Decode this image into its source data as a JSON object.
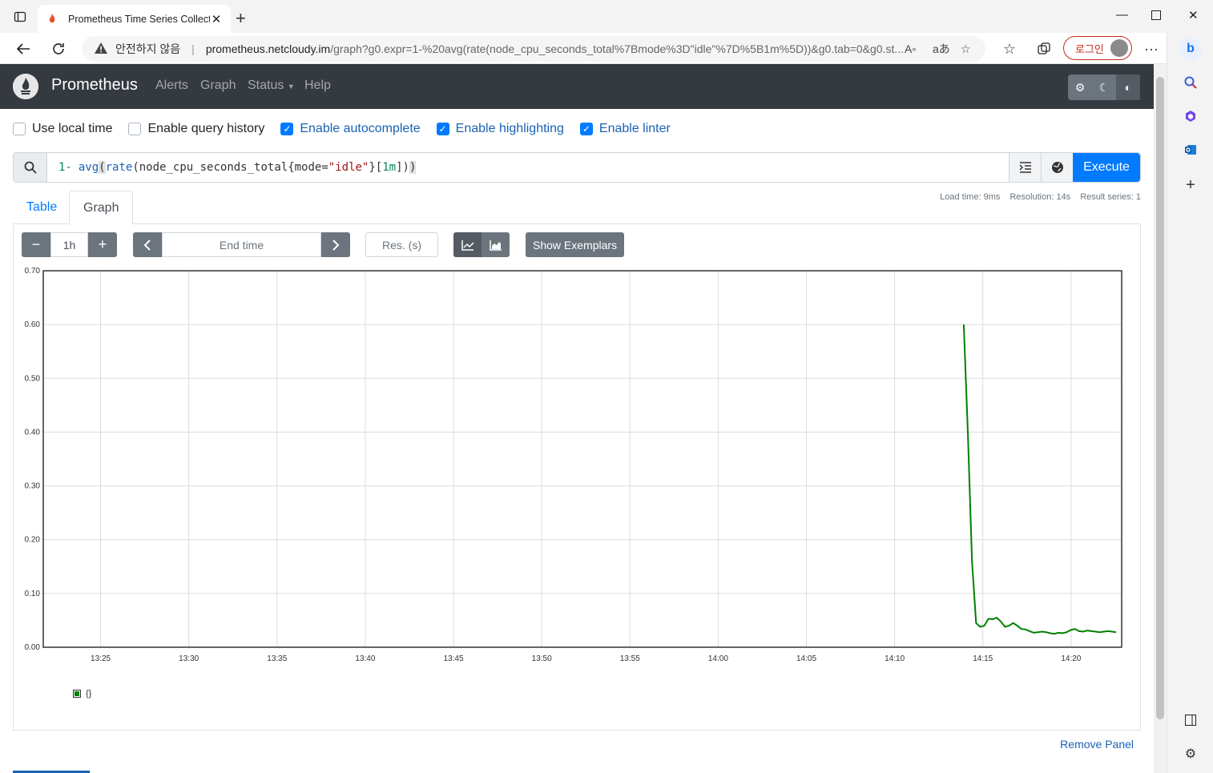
{
  "browser": {
    "tab_title": "Prometheus Time Series Collection and Processing Server",
    "insecure_label": "안전하지 않음",
    "url_host": "prometheus.netcloudy.im",
    "url_rest": "/graph?g0.expr=1-%20avg(rate(node_cpu_seconds_total%7Bmode%3D\"idle\"%7D%5B1m%5D))&g0.tab=0&g0.st...",
    "login_label": "로그인"
  },
  "navbar": {
    "brand": "Prometheus",
    "links": [
      "Alerts",
      "Graph",
      "Status",
      "Help"
    ]
  },
  "options": {
    "use_local_time": {
      "label": "Use local time",
      "checked": false
    },
    "query_history": {
      "label": "Enable query history",
      "checked": false
    },
    "autocomplete": {
      "label": "Enable autocomplete",
      "checked": true
    },
    "highlighting": {
      "label": "Enable highlighting",
      "checked": true
    },
    "linter": {
      "label": "Enable linter",
      "checked": true
    }
  },
  "query": {
    "num": "1-",
    "fn1": "avg",
    "fn2": "rate",
    "metric": "node_cpu_seconds_total",
    "label_key": "mode",
    "label_val": "\"idle\"",
    "duration": "1m",
    "execute_label": "Execute"
  },
  "meta": {
    "load_time": "Load time: 9ms",
    "resolution": "Resolution: 14s",
    "result_series": "Result series: 1"
  },
  "panel_tabs": {
    "table": "Table",
    "graph": "Graph"
  },
  "controls": {
    "range": "1h",
    "end_time_placeholder": "End time",
    "resolution_placeholder": "Res. (s)",
    "exemplars_label": "Show Exemplars"
  },
  "legend": {
    "series_label": "{}"
  },
  "remove_panel": "Remove Panel",
  "colors": {
    "series": "#008000",
    "accent": "#007bff",
    "navbar": "#343a40"
  },
  "chart_data": {
    "type": "line",
    "title": "",
    "xlabel": "",
    "ylabel": "",
    "ylim": [
      0,
      0.7
    ],
    "y_ticks": [
      "0.00",
      "0.10",
      "0.20",
      "0.30",
      "0.40",
      "0.50",
      "0.60",
      "0.70"
    ],
    "x_ticks": [
      "13:25",
      "13:30",
      "13:35",
      "13:40",
      "13:45",
      "13:50",
      "13:55",
      "14:00",
      "14:05",
      "14:10",
      "14:15",
      "14:20"
    ],
    "grid": true,
    "series": [
      {
        "name": "{}",
        "x": [
          "14:13:55",
          "14:14:09",
          "14:14:23",
          "14:14:37",
          "14:14:51",
          "14:15:05",
          "14:15:19",
          "14:15:33",
          "14:15:47",
          "14:16:01",
          "14:16:15",
          "14:16:29",
          "14:16:43",
          "14:16:57",
          "14:17:11",
          "14:17:25",
          "14:17:39",
          "14:17:53",
          "14:18:07",
          "14:18:21",
          "14:18:35",
          "14:18:49",
          "14:19:03",
          "14:19:17",
          "14:19:31",
          "14:19:45",
          "14:19:59",
          "14:20:13",
          "14:20:27",
          "14:20:41",
          "14:20:55",
          "14:21:09",
          "14:21:23",
          "14:21:37",
          "14:21:51",
          "14:22:05",
          "14:22:19",
          "14:22:33"
        ],
        "values": [
          0.6,
          0.4,
          0.16,
          0.045,
          0.038,
          0.04,
          0.053,
          0.052,
          0.055,
          0.048,
          0.038,
          0.04,
          0.045,
          0.04,
          0.034,
          0.033,
          0.03,
          0.027,
          0.028,
          0.029,
          0.028,
          0.026,
          0.025,
          0.027,
          0.026,
          0.028,
          0.032,
          0.034,
          0.03,
          0.029,
          0.031,
          0.03,
          0.029,
          0.028,
          0.029,
          0.03,
          0.029,
          0.028
        ]
      }
    ]
  }
}
